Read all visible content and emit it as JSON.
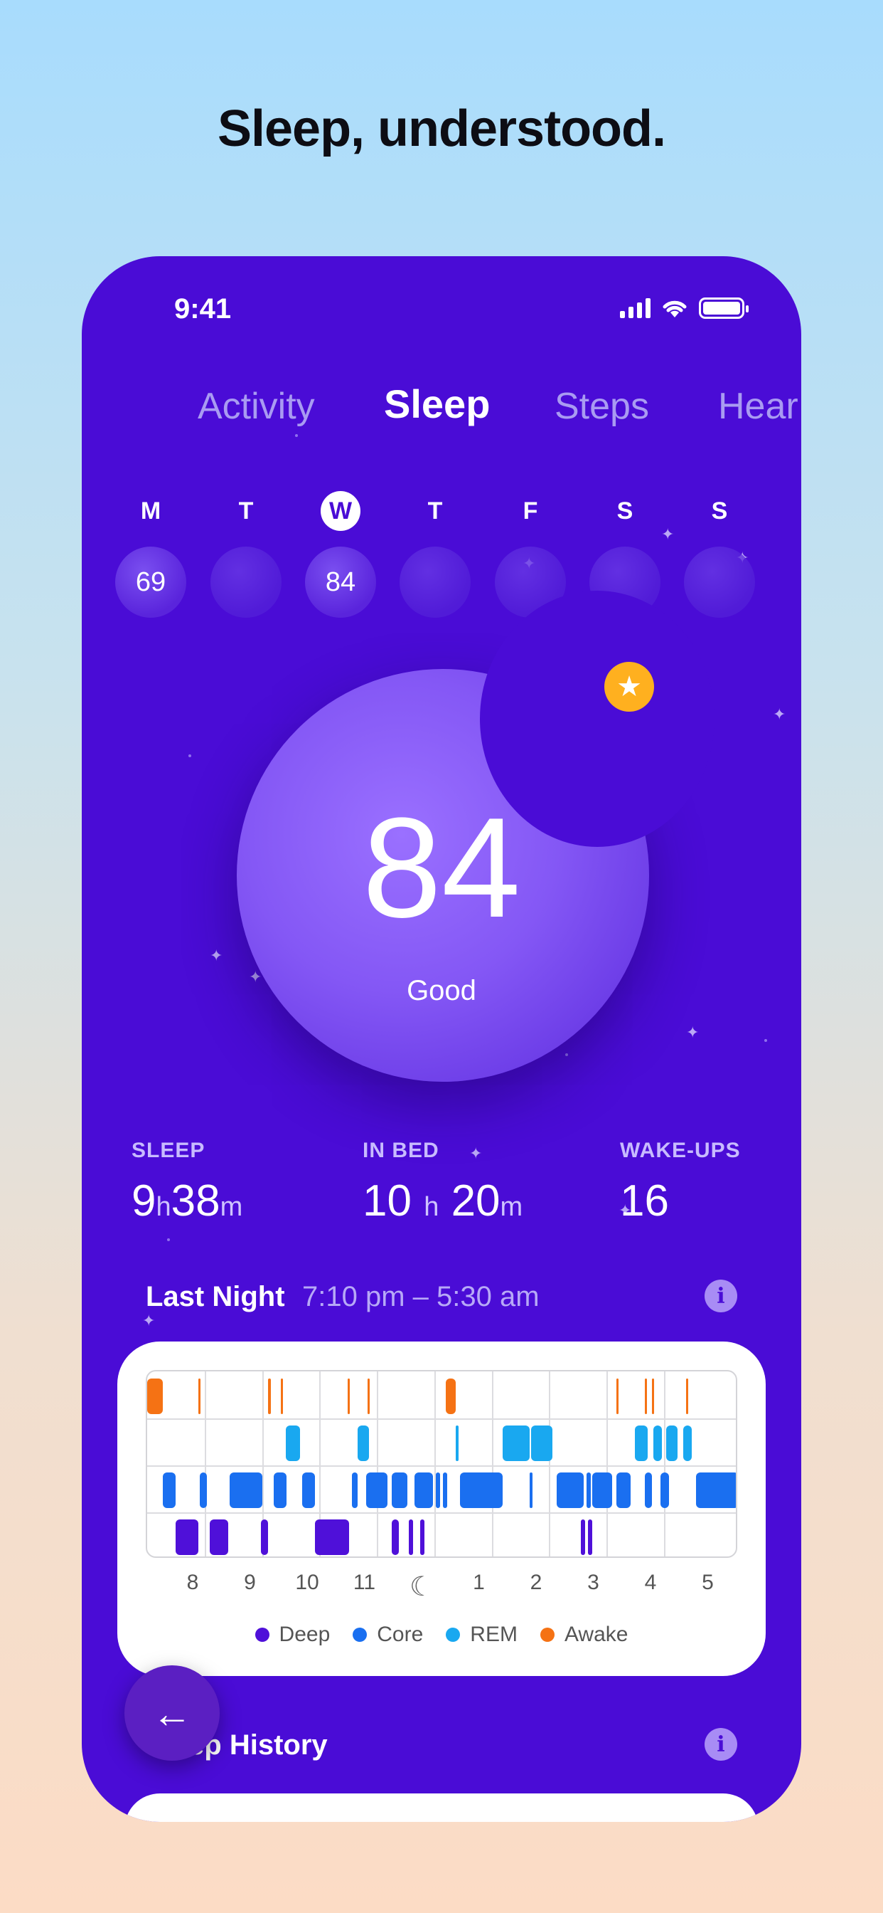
{
  "headline": "Sleep, understood.",
  "status": {
    "time": "9:41"
  },
  "tabs": [
    {
      "label": "Activity",
      "active": false
    },
    {
      "label": "Sleep",
      "active": true
    },
    {
      "label": "Steps",
      "active": false
    },
    {
      "label": "Hear",
      "active": false
    }
  ],
  "week": [
    {
      "letter": "M",
      "score": "69"
    },
    {
      "letter": "T",
      "score": ""
    },
    {
      "letter": "W",
      "score": "84",
      "selected": true
    },
    {
      "letter": "T",
      "score": ""
    },
    {
      "letter": "F",
      "score": ""
    },
    {
      "letter": "S",
      "score": ""
    },
    {
      "letter": "S",
      "score": ""
    }
  ],
  "score": {
    "value": "84",
    "label": "Good"
  },
  "metrics": {
    "sleep": {
      "label": "SLEEP",
      "h": "9",
      "h_unit": "h",
      "m": "38",
      "m_unit": "m"
    },
    "in_bed": {
      "label": "IN BED",
      "h": "10",
      "h_unit": "h",
      "m": "20",
      "m_unit": "m"
    },
    "wakeups": {
      "label": "WAKE-UPS",
      "value": "16"
    }
  },
  "last_night": {
    "title": "Last Night",
    "range": "7:10 pm – 5:30 am"
  },
  "chart_data": {
    "type": "timeline",
    "x_ticks": [
      "8",
      "9",
      "10",
      "11",
      "moon",
      "1",
      "2",
      "3",
      "4",
      "5"
    ],
    "rows": [
      "Awake",
      "REM",
      "Core",
      "Deep"
    ],
    "legend": [
      {
        "name": "Deep",
        "color": "#4f10d9"
      },
      {
        "name": "Core",
        "color": "#1a6ff0"
      },
      {
        "name": "REM",
        "color": "#19a8f0"
      },
      {
        "name": "Awake",
        "color": "#f57214"
      }
    ]
  },
  "history": {
    "title": "Sleep History"
  },
  "icons": {
    "back": "arrow-left-icon",
    "info": "info-icon",
    "badge": "star-icon",
    "midnight": "moon-icon"
  }
}
